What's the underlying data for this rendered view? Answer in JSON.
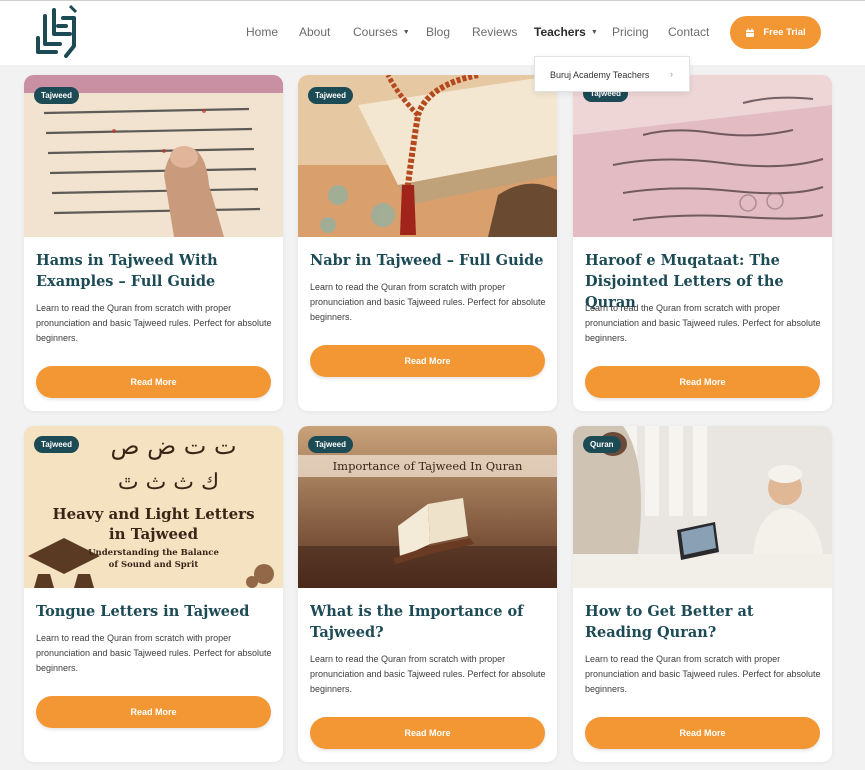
{
  "nav": {
    "items": [
      {
        "label": "Home"
      },
      {
        "label": "About"
      },
      {
        "label": "Courses"
      },
      {
        "label": "Blog"
      },
      {
        "label": "Reviews"
      },
      {
        "label": "Teachers"
      },
      {
        "label": "Pricing"
      },
      {
        "label": "Contact"
      }
    ],
    "cta_label": "Free Trial",
    "active": "Teachers"
  },
  "dropdown": {
    "items": [
      {
        "label": "Buruj Academy Teachers"
      }
    ]
  },
  "colors": {
    "accent": "#f29733",
    "brand": "#1c4a55",
    "badge": "#1c4a55"
  },
  "posts": [
    {
      "category": "Tajweed",
      "title": "Hams in Tajweed With Examples – Full Guide",
      "description": "Learn to read the Quran from scratch with proper pronunciation and basic Tajweed rules. Perfect for absolute beginners.",
      "button": "Read More"
    },
    {
      "category": "Tajweed",
      "title": "Nabr in Tajweed – Full Guide",
      "description": "Learn to read the Quran from scratch with proper pronunciation and basic Tajweed rules. Perfect for absolute beginners.",
      "button": "Read More"
    },
    {
      "category": "Tajweed",
      "title": "Haroof e Muqataat: The Disjointed Letters of the Quran",
      "description": "Learn to read the Quran from scratch with proper pronunciation and basic Tajweed rules. Perfect for absolute beginners.",
      "button": "Read More"
    },
    {
      "category": "Tajweed",
      "title": "Tongue Letters in Tajweed",
      "description": "Learn to read the Quran from scratch with proper pronunciation and basic Tajweed rules. Perfect for absolute beginners.",
      "button": "Read More",
      "image_text": {
        "arabic_top": "ت ت ض ص ",
        "arabic_bottom": "ك ث ث ٿ",
        "heading_line1": "Heavy and Light Letters",
        "heading_line2": "in Tajweed",
        "sub_line1": "Understanding the Balance",
        "sub_line2": "of Sound and Sprit"
      }
    },
    {
      "category": "Tajweed",
      "title": "What is the Importance of Tajweed?",
      "description": "Learn to read the Quran from scratch with proper pronunciation and basic Tajweed rules. Perfect for absolute beginners.",
      "button": "Read More",
      "image_text": {
        "banner": "Importance of Tajweed In Quran"
      }
    },
    {
      "category": "Quran",
      "title": "How to Get Better at Reading Quran?",
      "description": "Learn to read the Quran from scratch with proper pronunciation and basic Tajweed rules. Perfect for absolute beginners.",
      "button": "Read More"
    }
  ]
}
